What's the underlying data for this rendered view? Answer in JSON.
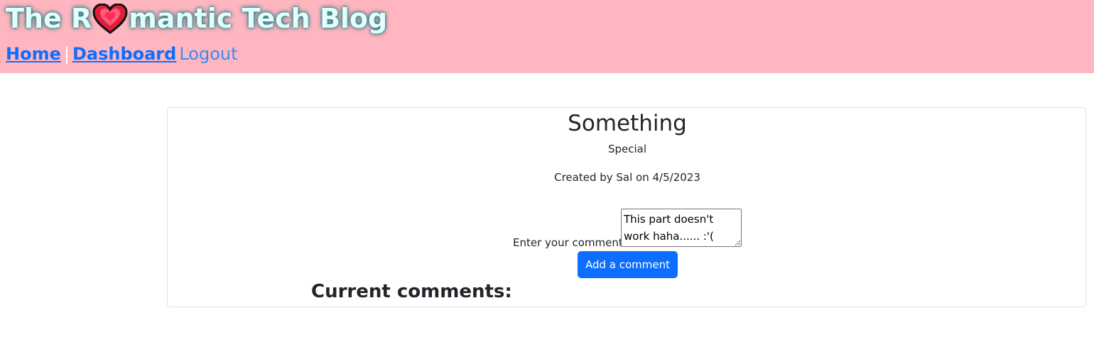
{
  "header": {
    "title_before": "The R",
    "title_after": "mantic Tech Blog",
    "logo_icon": "heart-icon",
    "colors": {
      "background": "#ffb6c1",
      "title": "#e0ffff",
      "link": "#0d6efd"
    },
    "nav": {
      "home": "Home",
      "separator": "|",
      "dashboard": "Dashboard",
      "logout": "Logout"
    }
  },
  "post": {
    "title": "Something",
    "body": "Special",
    "meta": "Created by Sal on 4/5/2023"
  },
  "comment_form": {
    "label": "Enter your comment:",
    "value": "This part doesn't work haha...... :'(",
    "button_label": "Add a comment",
    "button_color": "#0d6efd"
  },
  "comments": {
    "heading": "Current comments:"
  }
}
